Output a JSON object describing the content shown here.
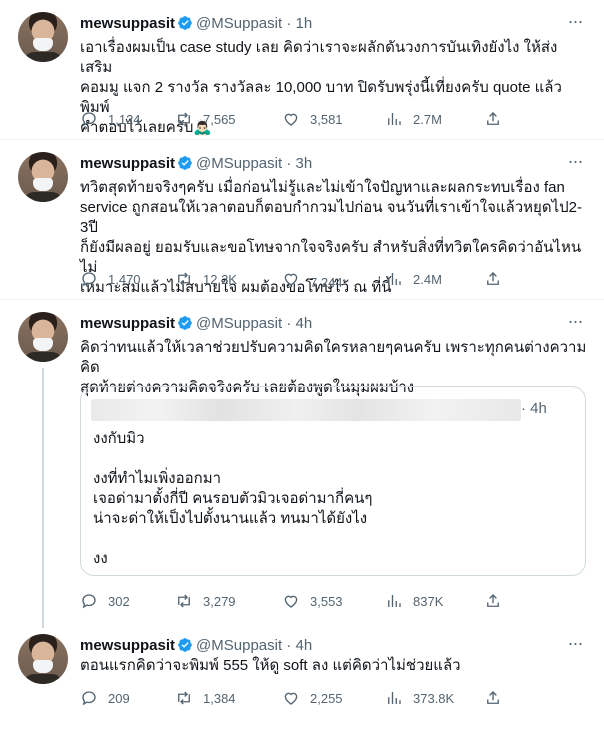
{
  "tweets": [
    {
      "name": "mewsuppasit",
      "handle": "@MSuppasit",
      "time": "· 1h",
      "text": "เอาเรื่องผมเป็น case study เลย คิดว่าเราจะผลักดันวงการบันเทิงยังไง ให้ส่งเสริม\nคอมมู แจก 2 รางวัล รางวัลละ 10,000 บาท ปิดรับพรุ่งนี้เที่ยงครับ quote แล้วพิมพ์\nคำตอบไว้เลยครับ🙇🏻‍♂️",
      "replies": "1,124",
      "retweets": "7,565",
      "likes": "3,581",
      "views": "2.7M"
    },
    {
      "name": "mewsuppasit",
      "handle": "@MSuppasit",
      "time": "· 3h",
      "text": "ทวิตสุดท้ายจริงๆครับ เมื่อก่อนไม่รู้และไม่เข้าใจปัญหาและผลกระทบเรื่อง fan\nservice ถูกสอนให้เวลาตอบก็ตอบกำกวมไปก่อน จนวันที่เราเข้าใจแล้วหยุดไป2-3ปี\nก็ยังมีผลอยู่ ยอมรับและขอโทษจากใจจริงครับ สำหรับสิ่งที่ทวิตใครคิดว่าอันไหนไม่\nเหมาะสมแล้วไม่สบายใจ ผมต้องขอโทษไว้ ณ ที่นี้",
      "replies": "1,470",
      "retweets": "12.2K",
      "likes": "7,244",
      "views": "2.4M"
    },
    {
      "name": "mewsuppasit",
      "handle": "@MSuppasit",
      "time": "· 4h",
      "text": "คิดว่าทนแล้วให้เวลาช่วยปรับความคิดใครหลายๆคนครับ เพราะทุกคนต่างความคิด\nสุดท้ายต่างความคิดจริงครับ เลยต้องพูดในมุมผมบ้าง",
      "quote": {
        "time": "· 4h",
        "text": "งงกับมิว\n\nงงที่ทำไมเพิ่งออกมา\nเจอด่ามาตั้งกี่ปี คนรอบตัวมิวเจอด่ามากี่คนๆ\nน่าจะด่าให้เป็งไปตั้งนานแล้ว ทนมาได้ยังไง\n\nงง"
      },
      "replies": "302",
      "retweets": "3,279",
      "likes": "3,553",
      "views": "837K"
    },
    {
      "name": "mewsuppasit",
      "handle": "@MSuppasit",
      "time": "· 4h",
      "text": "ตอนแรกคิดว่าจะพิมพ์ 555 ให้ดู soft ลง แต่คิดว่าไม่ช่วยแล้ว",
      "replies": "209",
      "retweets": "1,384",
      "likes": "2,255",
      "views": "373.8K"
    }
  ],
  "icons": {
    "verified": "verified-badge-icon",
    "more": "more-options-icon",
    "reply": "reply-icon",
    "retweet": "retweet-icon",
    "like": "heart-icon",
    "views": "views-chart-icon",
    "share": "share-icon"
  },
  "colors": {
    "verified": "#1d9bf0",
    "muted": "#536471",
    "text": "#0f1419",
    "border": "#eff3f4"
  }
}
